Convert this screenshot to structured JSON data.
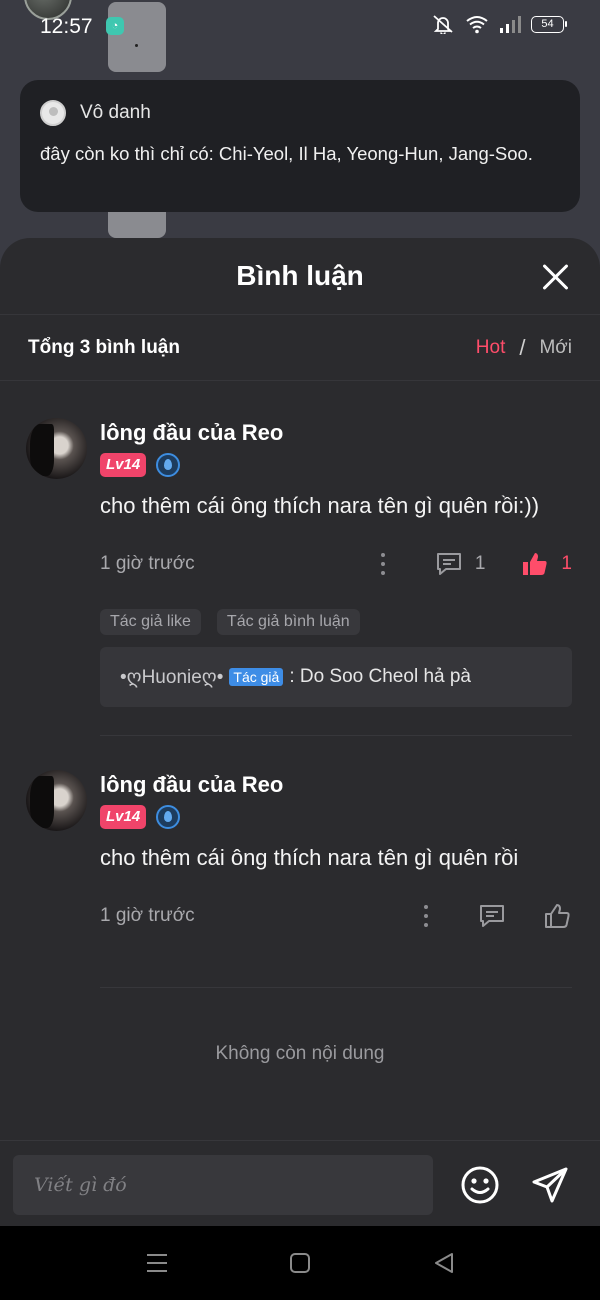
{
  "status_bar": {
    "time": "12:57",
    "battery": "54"
  },
  "notification": {
    "sender": "Vô danh",
    "message": "đây còn ko thì chỉ có: Chi-Yeol, Il Ha, Yeong-Hun, Jang-Soo."
  },
  "sheet": {
    "title": "Bình luận",
    "total_comments": "Tổng 3 bình luận",
    "sort_hot": "Hot",
    "sort_separator": "/",
    "sort_new": "Mới",
    "accent_color": "#ff4d6a"
  },
  "comments": [
    {
      "author": "lông đầu của Reo",
      "level": "Lv14",
      "text": "cho thêm cái ông thích nara tên gì quên rồi:))",
      "time": "1 giờ trước",
      "reply_count": "1",
      "like_count": "1",
      "liked": true,
      "tags": [
        "Tác giả like",
        "Tác giả bình luận"
      ],
      "reply": {
        "user": "•ღHuonieღ•",
        "author_tag": "Tác giả",
        "text": ": Do Soo Cheol hả pà"
      }
    },
    {
      "author": "lông đầu của Reo",
      "level": "Lv14",
      "text": "cho thêm cái ông thích nara tên gì quên rồi",
      "time": "1 giờ trước",
      "liked": false
    }
  ],
  "end_message": "Không còn nội dung",
  "composer": {
    "placeholder": "Viết gì đó"
  }
}
